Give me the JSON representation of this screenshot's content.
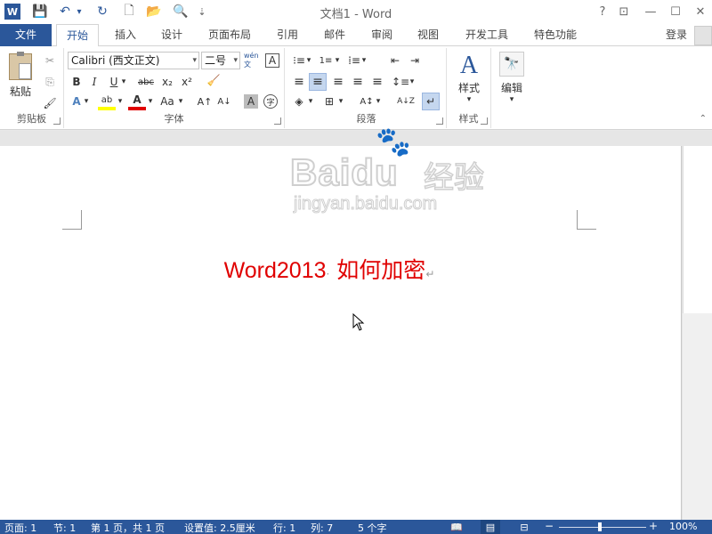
{
  "window": {
    "title": "文档1 - Word",
    "help_icon": "?",
    "ribbon_display_icon": "⊡",
    "minimize_icon": "—",
    "maximize_icon": "☐",
    "close_icon": "✕"
  },
  "quick_access": {
    "app_icon": "W",
    "save_icon": "💾",
    "undo_icon": "↶",
    "undo_dropdown": "▾",
    "redo_icon": "↻",
    "new_icon": "🗋",
    "open_icon": "📂",
    "preview_icon": "🔍",
    "customize_icon": "⇣"
  },
  "tabs": [
    "文件",
    "开始",
    "插入",
    "设计",
    "页面布局",
    "引用",
    "邮件",
    "审阅",
    "视图",
    "开发工具",
    "特色功能"
  ],
  "sign_in": "登录",
  "ribbon": {
    "clipboard": {
      "label": "剪贴板",
      "paste": "粘贴",
      "cut_icon": "✂",
      "copy_icon": "⎘",
      "format_painter_icon": "🖌"
    },
    "font": {
      "label": "字体",
      "font_name": "Calibri (西文正文)",
      "font_size": "二号",
      "phonetic_guide": "wén文",
      "char_border": "A",
      "bold": "B",
      "italic": "I",
      "underline": "U",
      "strikethrough": "abc",
      "subscript": "x₂",
      "superscript": "x²",
      "clear_format_icon": "🧹",
      "text_effects": "A",
      "highlight": "ab",
      "font_color": "A",
      "change_case": "Aa",
      "grow_font": "A↑",
      "shrink_font": "A↓",
      "char_shading": "A",
      "enclose_char": "字"
    },
    "paragraph": {
      "label": "段落",
      "bullets_icon": "⁝≡",
      "numbering_icon": "1≡",
      "multilevel_icon": "⁞≡",
      "decrease_indent_icon": "⇤",
      "increase_indent_icon": "⇥",
      "chinese_layout_icon": "A↕",
      "sort_icon": "A↓Z",
      "show_marks_icon": "↵",
      "align_left_icon": "≡",
      "center_icon": "≡",
      "align_right_icon": "≡",
      "justify_icon": "≡",
      "distributed_icon": "≡",
      "line_spacing_icon": "↕≡",
      "shading_icon": "◈",
      "borders_icon": "⊞"
    },
    "styles": {
      "label": "样式",
      "button": "样式",
      "icon": "A"
    },
    "editing": {
      "label": "",
      "button": "编辑",
      "icon": "🔭"
    }
  },
  "document": {
    "heading_en": "Word2013",
    "space_mark": "·",
    "heading_cn": "如何加密",
    "paragraph_mark": "↵"
  },
  "watermark": {
    "brand": "Baidu",
    "jingyan": "经验",
    "url": "jingyan.baidu.com"
  },
  "status_bar": {
    "page": "页面: 1",
    "section": "节: 1",
    "page_of": "第 1 页，共 1 页",
    "position": "设置值: 2.5厘米",
    "line": "行: 1",
    "column": "列: 7",
    "word_count": "5 个字",
    "zoom_out": "−",
    "zoom_in": "+",
    "zoom": "100%",
    "zoom_level": 1.0
  },
  "colors": {
    "accent": "#2b579a",
    "heading": "#e00000"
  }
}
